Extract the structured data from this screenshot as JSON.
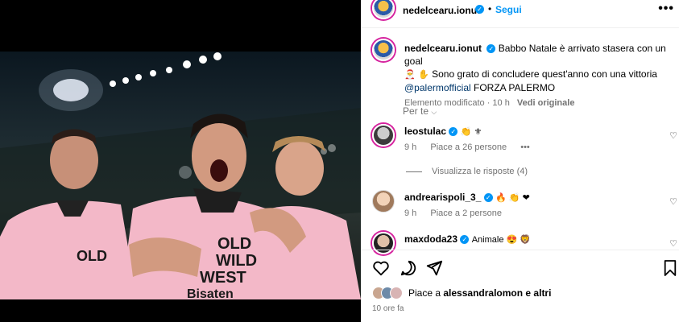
{
  "post": {
    "author": "nedelcearu.ionut",
    "follow_label": "Segui",
    "more_label": "•••",
    "dot": "•"
  },
  "caption": {
    "text_1": "Babbo Natale è arrivato stasera con un goal",
    "text_2": "Sono grato di concludere quest'anno con una vittoria",
    "mention": "@palermofficial",
    "text_3": "FORZA PALERMO",
    "edited": "Elemento modificato · 10 h",
    "see_original": "Vedi originale",
    "emoji_santa": "🎅",
    "emoji_hand": "✋"
  },
  "for_you": "Per te",
  "comments": [
    {
      "user": "leostulac",
      "text": "👏 ⚜",
      "time": "9 h",
      "likes": "Piace a 26 persone",
      "more": "•••",
      "heart": "♡"
    },
    {
      "user": "andrearispoli_3_",
      "text": "🔥 👏 ❤",
      "time": "9 h",
      "likes": "Piace a 2 persone",
      "heart": "♡"
    },
    {
      "user": "maxdoda23",
      "text": "Animale 😍 🦁",
      "heart": "♡"
    }
  ],
  "view_replies": "Visualizza le risposte (4)",
  "likes": {
    "prefix": "Piace a",
    "user": "alessandralomon",
    "suffix": "e altri"
  },
  "timestamp": "10 ore fa",
  "photo": {
    "jersey_text_1": "OLD",
    "jersey_text_2": "WILD",
    "jersey_text_3": "WEST",
    "sponsor": "Bisaten"
  },
  "colors": {
    "accent": "#0095f6",
    "muted": "#737373",
    "jersey": "#f3b8c8"
  }
}
